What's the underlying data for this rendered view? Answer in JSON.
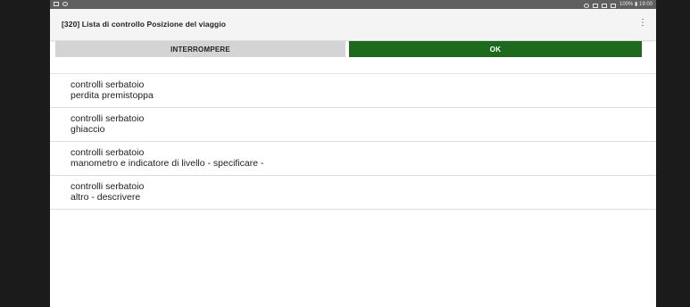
{
  "statusbar": {
    "right_text": "100% ▮ 19:00"
  },
  "header": {
    "title": "[320] Lista di controllo Posizione del viaggio",
    "menu_icon": "⋮"
  },
  "buttons": {
    "cancel_label": "INTERROMPERE",
    "ok_label": "OK"
  },
  "items": [
    {
      "line1": "controlli serbatoio",
      "line2": "perdita premistoppa"
    },
    {
      "line1": "controlli serbatoio",
      "line2": "ghiaccio"
    },
    {
      "line1": "controlli serbatoio",
      "line2": "manometro e indicatore di livello - specificare -"
    },
    {
      "line1": "controlli serbatoio",
      "line2": "altro - descrivere"
    }
  ],
  "colors": {
    "ok": "#1d6a1e",
    "cancel": "#d4d4d4",
    "statusbar": "#5f5f5f"
  }
}
